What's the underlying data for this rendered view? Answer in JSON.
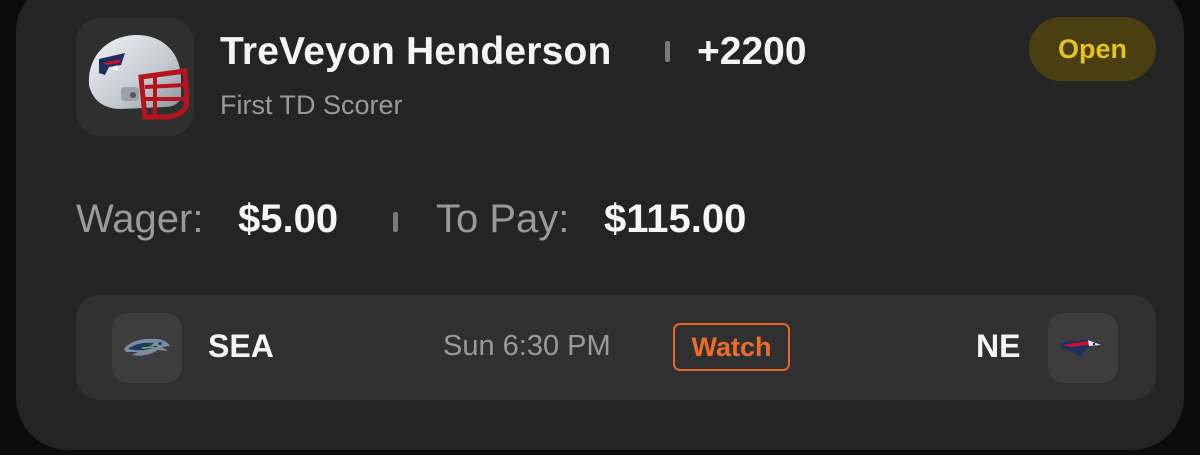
{
  "bet": {
    "player_name": "TreVeyon Henderson",
    "odds": "+2200",
    "market": "First TD Scorer",
    "status": "Open",
    "status_color": "#e8c21e",
    "helmet_icon": "patriots-helmet-icon"
  },
  "amounts": {
    "wager_label": "Wager:",
    "wager_value": "$5.00",
    "topay_label": "To Pay:",
    "topay_value": "$115.00"
  },
  "game": {
    "away_team": "SEA",
    "away_icon": "seahawks-logo-icon",
    "time": "Sun 6:30 PM",
    "watch_label": "Watch",
    "watch_color": "#ef6c2c",
    "home_team": "NE",
    "home_icon": "patriots-logo-icon"
  },
  "colors": {
    "card_bg": "#242424",
    "page_bg": "#0b0b0b"
  }
}
